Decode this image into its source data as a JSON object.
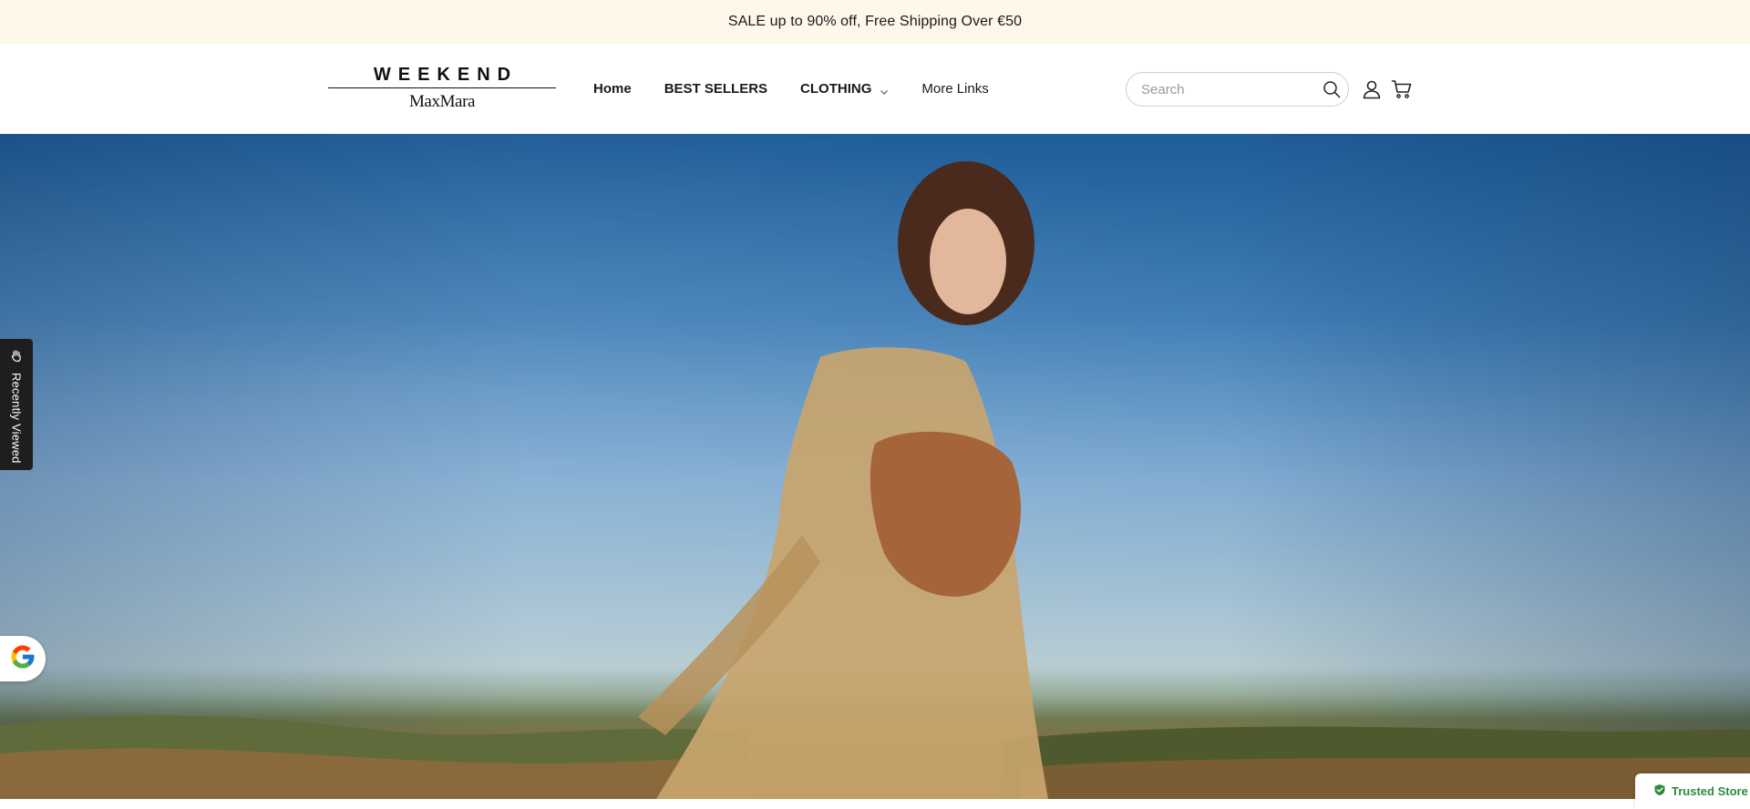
{
  "announcement": {
    "text": "SALE up to 90% off, Free Shipping Over €50"
  },
  "logo": {
    "top": "WEEKEND",
    "bottom": "MaxMara"
  },
  "nav": {
    "items": [
      {
        "label": "Home"
      },
      {
        "label": "BEST SELLERS"
      },
      {
        "label": "CLOTHING"
      },
      {
        "label": "More Links"
      }
    ]
  },
  "search": {
    "placeholder": "Search"
  },
  "icons": {
    "search": "search-icon",
    "account": "account-icon",
    "cart": "cart-icon",
    "recent": "hand-icon",
    "google": "google-icon",
    "trusted": "shield-check-icon"
  },
  "sidebar": {
    "recently_viewed": "Recently Viewed"
  },
  "trusted_store": {
    "label": "Trusted Store"
  },
  "colors": {
    "announcement_bg": "#fef8ea",
    "trusted_green": "#2e8b3a"
  }
}
